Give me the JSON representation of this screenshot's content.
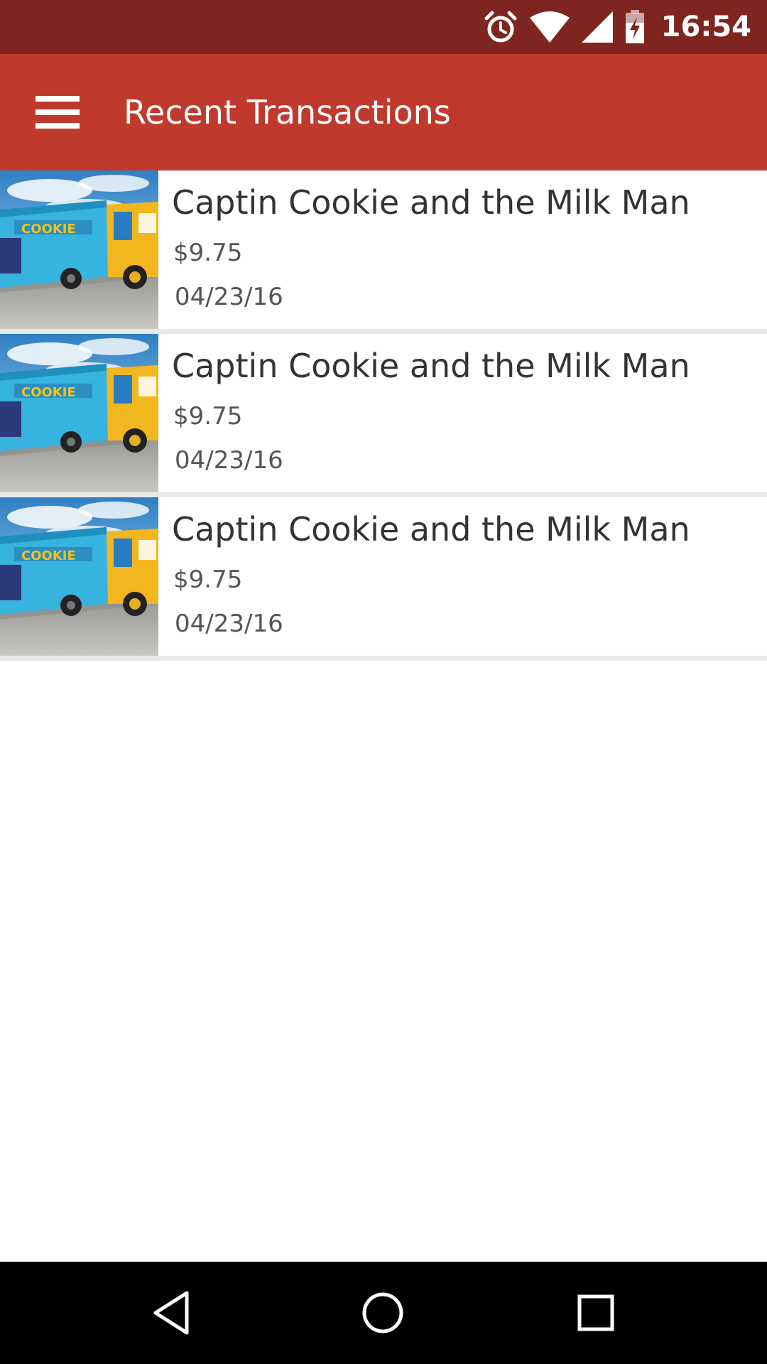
{
  "status_bar": {
    "time": "16:54",
    "icons": [
      "alarm-icon",
      "wifi-icon",
      "cell-signal-icon",
      "battery-charging-icon"
    ]
  },
  "app_bar": {
    "title": "Recent Transactions",
    "menu_icon": "hamburger-menu-icon",
    "background_color": "#c0392d",
    "status_bar_color": "#7f251f"
  },
  "transactions": [
    {
      "name": "Captin Cookie and the Milk Man",
      "amount": "$9.75",
      "date": "04/23/16",
      "thumbnail": "food-truck-image"
    },
    {
      "name": "Captin Cookie and the Milk Man",
      "amount": "$9.75",
      "date": "04/23/16",
      "thumbnail": "food-truck-image"
    },
    {
      "name": "Captin Cookie and the Milk Man",
      "amount": "$9.75",
      "date": "04/23/16",
      "thumbnail": "food-truck-image"
    }
  ],
  "nav_bar": {
    "icons": [
      "back-icon",
      "home-icon",
      "recents-icon"
    ]
  }
}
